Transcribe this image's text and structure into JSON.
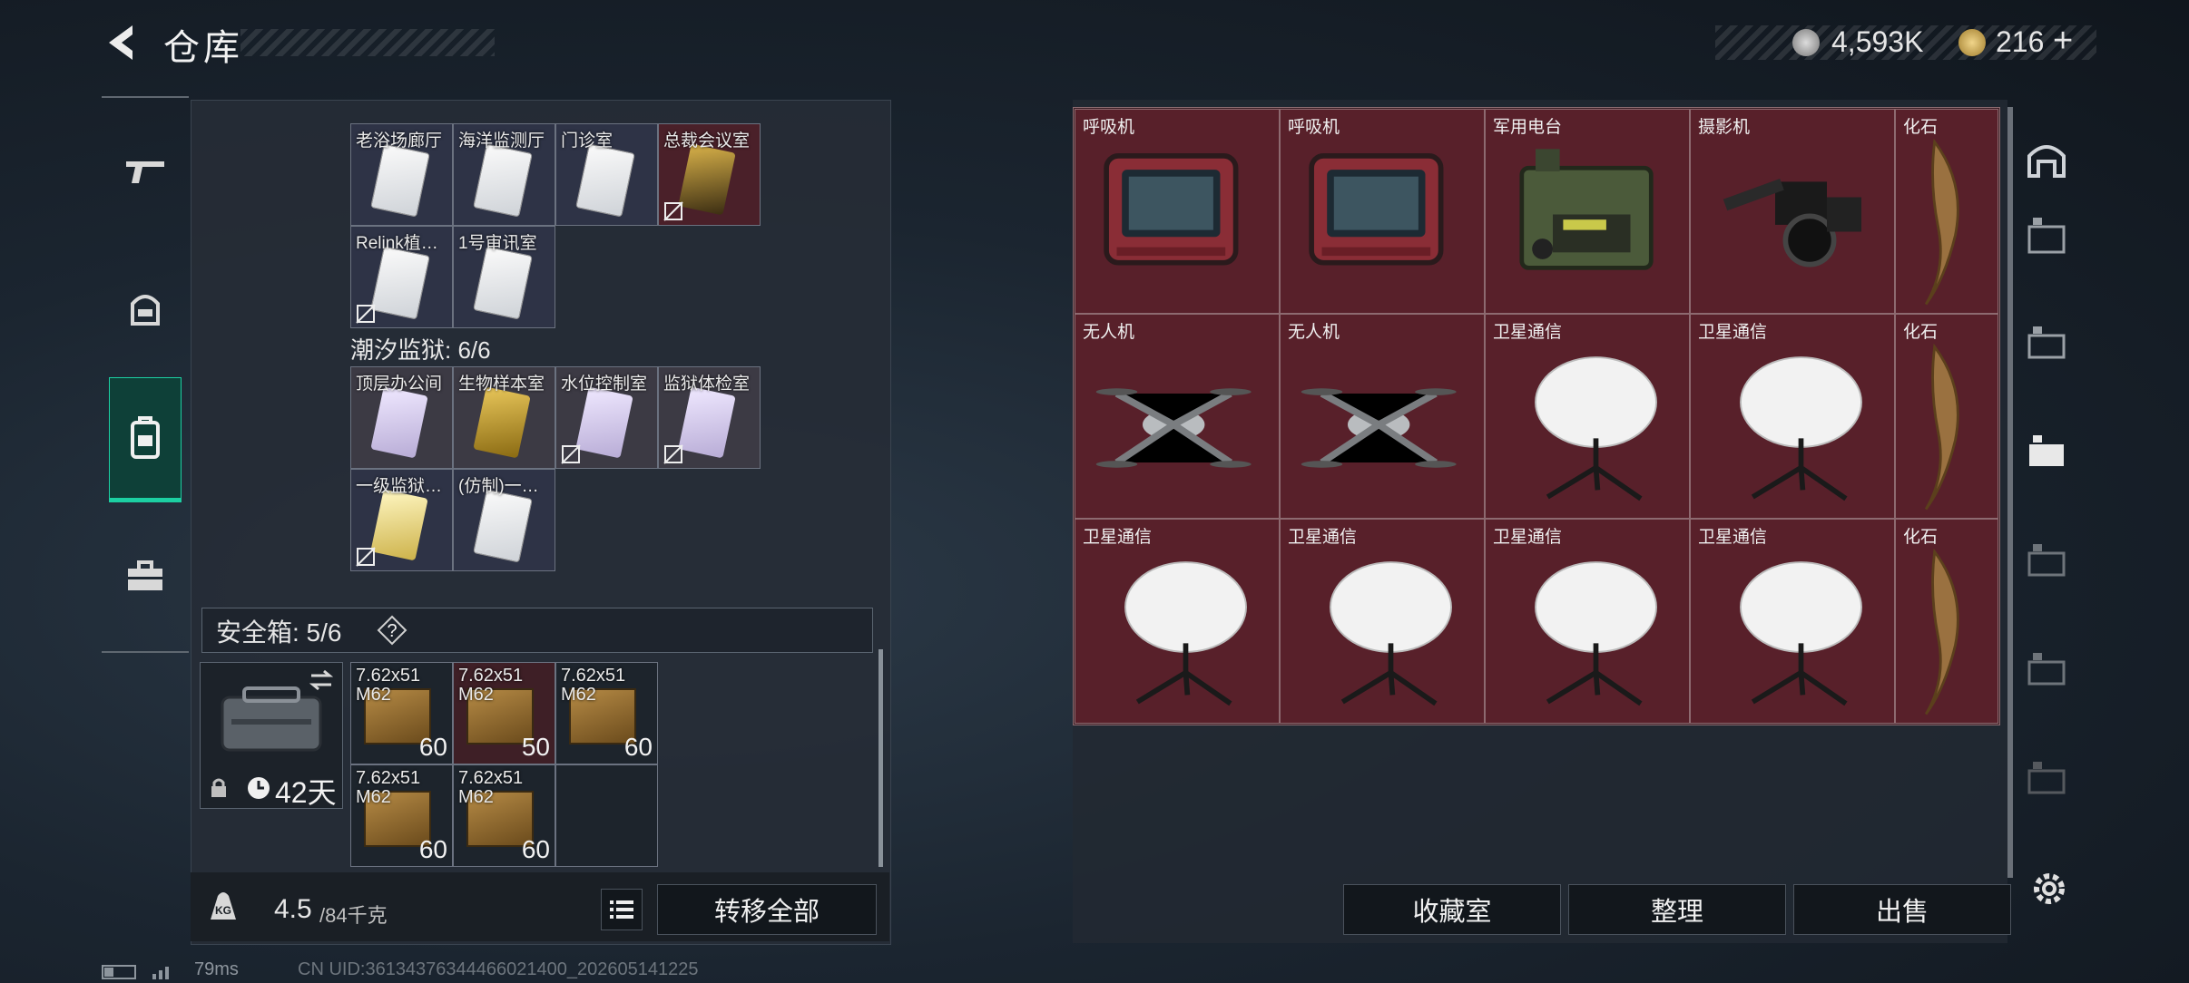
{
  "header": {
    "title": "仓库"
  },
  "currency": {
    "silver": "4,593K",
    "gold": "216",
    "plus": "+"
  },
  "rail": [
    "weapon-tab",
    "armor-tab",
    "backpack-tab",
    "case-tab"
  ],
  "left": {
    "map1_cells": [
      {
        "label": "老浴场廊厅",
        "card": "white",
        "nokey": false
      },
      {
        "label": "海洋监测厅",
        "card": "white",
        "nokey": false
      },
      {
        "label": "门诊室",
        "card": "white",
        "nokey": false
      },
      {
        "label": "总裁会议室",
        "card": "dark",
        "nokey": true
      },
      {
        "label": "Relink植…",
        "card": "white",
        "nokey": true
      },
      {
        "label": "1号审讯室",
        "card": "white",
        "nokey": false
      }
    ],
    "map2_title": "潮汐监狱: 6/6",
    "map2_cells": [
      {
        "label": "顶层办公间",
        "card": "purple",
        "nokey": false
      },
      {
        "label": "生物样本室",
        "card": "gold",
        "nokey": false
      },
      {
        "label": "水位控制室",
        "card": "purple",
        "nokey": true
      },
      {
        "label": "监狱体检室",
        "card": "purple",
        "nokey": true
      },
      {
        "label": "一级监狱…",
        "card": "yellow",
        "nokey": true
      },
      {
        "label": "(仿制)一…",
        "card": "white",
        "nokey": false
      }
    ],
    "safe_label": "安全箱: 5/6",
    "safe_help": "?",
    "safe_days": "42天",
    "ammo": [
      {
        "l1": "7.62x51",
        "l2": "M62",
        "count": "60"
      },
      {
        "l1": "7.62x51",
        "l2": "M62",
        "count": "50"
      },
      {
        "l1": "7.62x51",
        "l2": "M62",
        "count": "60"
      },
      {
        "l1": "7.62x51",
        "l2": "M62",
        "count": "60"
      },
      {
        "l1": "7.62x51",
        "l2": "M62",
        "count": "60"
      }
    ],
    "weight_cur": "4.5",
    "weight_max": "/84千克",
    "weight_icon_text": "KG",
    "transfer": "转移全部"
  },
  "right": {
    "rows": [
      [
        {
          "label": "呼吸机",
          "kind": "breather"
        },
        {
          "label": "呼吸机",
          "kind": "breather"
        },
        {
          "label": "军用电台",
          "kind": "radio"
        },
        {
          "label": "摄影机",
          "kind": "camera"
        },
        {
          "label": "化石",
          "kind": "fossil"
        }
      ],
      [
        {
          "label": "无人机",
          "kind": "drone"
        },
        {
          "label": "无人机",
          "kind": "drone"
        },
        {
          "label": "卫星通信",
          "kind": "dish"
        },
        {
          "label": "卫星通信",
          "kind": "dish"
        },
        {
          "label": "化石",
          "kind": "fossil"
        }
      ],
      [
        {
          "label": "卫星通信",
          "kind": "dish"
        },
        {
          "label": "卫星通信",
          "kind": "dish"
        },
        {
          "label": "卫星通信",
          "kind": "dish"
        },
        {
          "label": "卫星通信",
          "kind": "dish"
        },
        {
          "label": "化石",
          "kind": "fossil"
        }
      ]
    ],
    "btn_collect": "收藏室",
    "btn_sort": "整理",
    "btn_sell": "出售"
  },
  "footer": {
    "ms": "79ms",
    "uid": "CN UID:36134376344466021400_202605141225"
  },
  "colors": {
    "accent": "#1ccfa2",
    "grid_bg": "#6e202d"
  }
}
